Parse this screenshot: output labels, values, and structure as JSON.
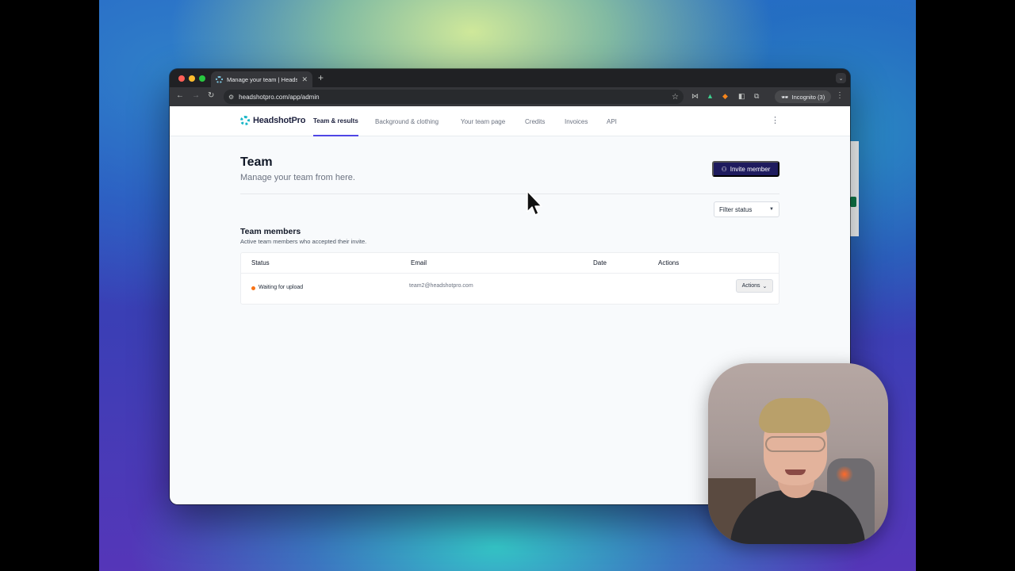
{
  "browser": {
    "tab_title": "Manage your team | Headsho",
    "url": "headshotpro.com/app/admin",
    "incognito_label": "Incognito (3)"
  },
  "header": {
    "brand": "HeadshotPro",
    "nav": [
      {
        "label": "Team & results",
        "active": true
      },
      {
        "label": "Background & clothing"
      },
      {
        "label": "Your team page"
      },
      {
        "label": "Credits"
      },
      {
        "label": "Invoices"
      },
      {
        "label": "API"
      }
    ]
  },
  "main": {
    "title": "Team",
    "subtitle": "Manage your team from here.",
    "invite_button": "Invite member",
    "filter_label": "Filter status"
  },
  "members": {
    "title": "Team members",
    "subtitle": "Active team members who accepted their invite.",
    "columns": [
      "Status",
      "Email",
      "Date",
      "Actions"
    ],
    "rows": [
      {
        "status": "Waiting for upload",
        "email": "team2@headshotpro.com",
        "date": "",
        "actions": "Actions"
      }
    ]
  },
  "colors": {
    "brand_navy": "#1e1b5e",
    "accent": "#4f46e5",
    "status_waiting": "#f97316"
  }
}
